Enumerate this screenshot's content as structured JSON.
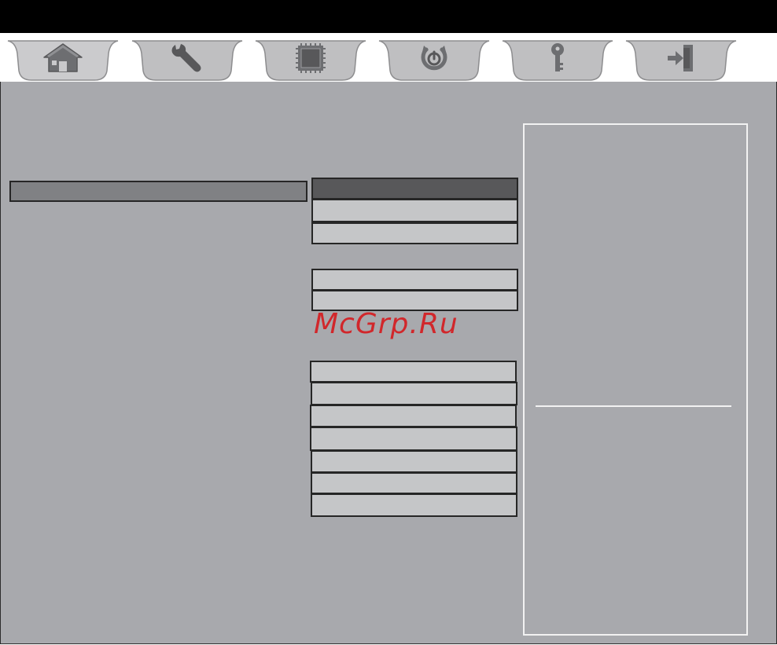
{
  "tabs": [
    {
      "id": "main",
      "icon": "home-icon",
      "active": true
    },
    {
      "id": "advanced",
      "icon": "wrench-icon",
      "active": false
    },
    {
      "id": "chipset",
      "icon": "chip-icon",
      "active": false
    },
    {
      "id": "boot",
      "icon": "power-icon",
      "active": false
    },
    {
      "id": "security",
      "icon": "key-icon",
      "active": false
    },
    {
      "id": "exit",
      "icon": "exit-door-icon",
      "active": false
    }
  ],
  "watermark": "McGrp.Ru",
  "colors": {
    "titlebar": "#000000",
    "panel": "#a8a9ad",
    "field": "#c5c6c8",
    "field_selected": "#58585a",
    "label_highlight": "#808184",
    "help_border": "#f2f2f2",
    "watermark": "#d1272b"
  }
}
